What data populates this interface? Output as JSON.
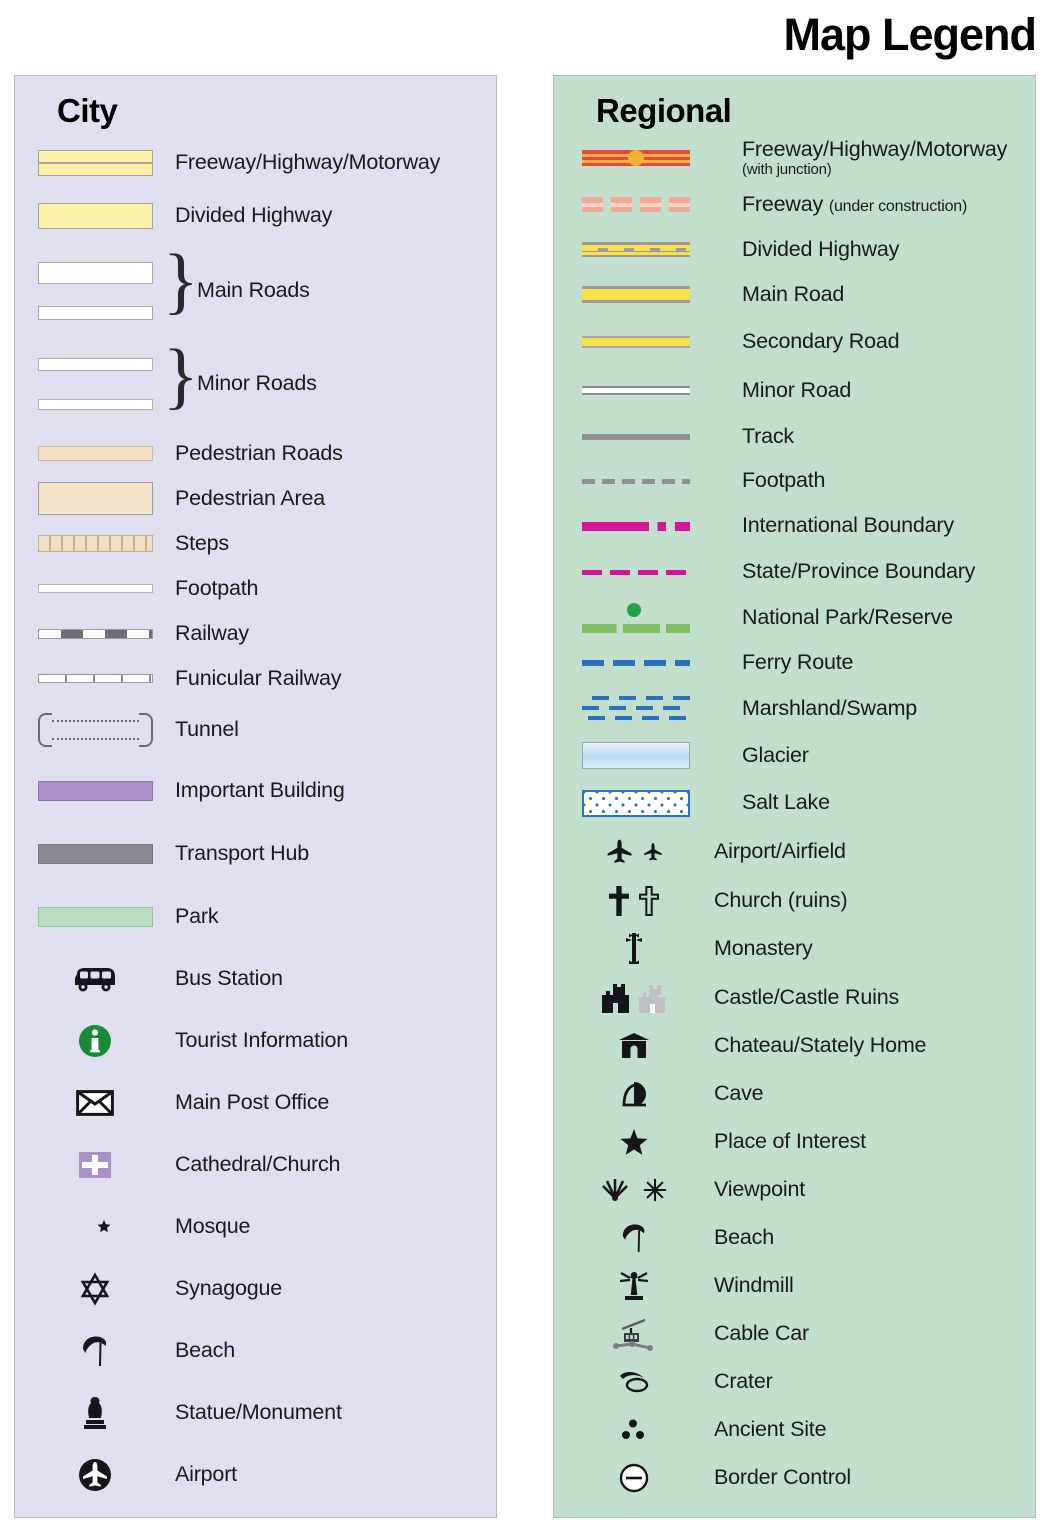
{
  "title": "Map Legend",
  "city": {
    "heading": "City",
    "bg_color": "#e0dff0",
    "items": [
      {
        "label": "Freeway/Highway/Motorway",
        "symbol": "freeway-bar"
      },
      {
        "label": "Divided Highway",
        "symbol": "divided-highway-bar"
      },
      {
        "label": "Main Roads",
        "symbol": "main-roads-pair-braced"
      },
      {
        "label": "Minor Roads",
        "symbol": "minor-roads-pair-braced"
      },
      {
        "label": "Pedestrian Roads",
        "symbol": "pedestrian-road-bar"
      },
      {
        "label": "Pedestrian Area",
        "symbol": "pedestrian-area-bar"
      },
      {
        "label": "Steps",
        "symbol": "steps-bar"
      },
      {
        "label": "Footpath",
        "symbol": "footpath-bar"
      },
      {
        "label": "Railway",
        "symbol": "railway-bar"
      },
      {
        "label": "Funicular Railway",
        "symbol": "funicular-railway-bar"
      },
      {
        "label": "Tunnel",
        "symbol": "tunnel-bracket"
      },
      {
        "label": "Important Building",
        "symbol": "important-building-bar"
      },
      {
        "label": "Transport Hub",
        "symbol": "transport-hub-bar"
      },
      {
        "label": "Park",
        "symbol": "park-bar"
      },
      {
        "label": "Bus Station",
        "symbol": "bus-icon"
      },
      {
        "label": "Tourist Information",
        "symbol": "info-circle-icon"
      },
      {
        "label": "Main Post Office",
        "symbol": "envelope-icon"
      },
      {
        "label": "Cathedral/Church",
        "symbol": "cross-square-icon"
      },
      {
        "label": "Mosque",
        "symbol": "crescent-star-icon"
      },
      {
        "label": "Synagogue",
        "symbol": "star-of-david-icon"
      },
      {
        "label": "Beach",
        "symbol": "beach-umbrella-icon"
      },
      {
        "label": "Statue/Monument",
        "symbol": "statue-icon"
      },
      {
        "label": "Airport",
        "symbol": "airport-circle-icon"
      }
    ]
  },
  "regional": {
    "heading": "Regional",
    "bg_color": "#c2dfcd",
    "items": [
      {
        "label": "Freeway/Highway/Motorway",
        "sub": "(with junction)",
        "symbol": "freeway-junction-line"
      },
      {
        "label": "Freeway ",
        "inline_sub": "(under construction)",
        "symbol": "freeway-under-construction-line"
      },
      {
        "label": "Divided Highway",
        "symbol": "divided-highway-line"
      },
      {
        "label": "Main Road",
        "symbol": "main-road-line"
      },
      {
        "label": "Secondary Road",
        "symbol": "secondary-road-line"
      },
      {
        "label": "Minor Road",
        "symbol": "minor-road-line"
      },
      {
        "label": "Track",
        "symbol": "track-line"
      },
      {
        "label": "Footpath",
        "symbol": "footpath-dashed-line"
      },
      {
        "label": "International Boundary",
        "symbol": "international-boundary-line"
      },
      {
        "label": "State/Province Boundary",
        "symbol": "state-boundary-line"
      },
      {
        "label": "National Park/Reserve",
        "symbol": "national-park-line"
      },
      {
        "label": "Ferry Route",
        "symbol": "ferry-route-line"
      },
      {
        "label": "Marshland/Swamp",
        "symbol": "marshland-pattern"
      },
      {
        "label": "Glacier",
        "symbol": "glacier-swatch"
      },
      {
        "label": "Salt Lake",
        "symbol": "salt-lake-swatch"
      },
      {
        "label": "Airport/Airfield",
        "symbol": "airplane-pair-icon"
      },
      {
        "label": "Church (ruins)",
        "symbol": "cross-pair-icon"
      },
      {
        "label": "Monastery",
        "symbol": "monastery-cross-icon"
      },
      {
        "label": "Castle/Castle Ruins",
        "symbol": "castle-pair-icon"
      },
      {
        "label": "Chateau/Stately Home",
        "symbol": "chateau-icon"
      },
      {
        "label": "Cave",
        "symbol": "cave-icon"
      },
      {
        "label": "Place of Interest",
        "symbol": "star-icon"
      },
      {
        "label": "Viewpoint",
        "symbol": "viewpoint-pair-icon"
      },
      {
        "label": "Beach",
        "symbol": "beach-umbrella-icon"
      },
      {
        "label": "Windmill",
        "symbol": "windmill-icon"
      },
      {
        "label": "Cable Car",
        "symbol": "cable-car-icon"
      },
      {
        "label": "Crater",
        "symbol": "crater-icon"
      },
      {
        "label": "Ancient Site",
        "symbol": "ancient-site-icon"
      },
      {
        "label": "Border Control",
        "symbol": "border-control-icon"
      }
    ]
  },
  "colors": {
    "city_panel": "#e0dff0",
    "regional_panel": "#c2dfcd",
    "highway_yellow": "#fbf0a8",
    "freeway_red": "#e04a43",
    "junction_orange": "#f4b233",
    "main_road_yellow": "#f7e04a",
    "boundary_magenta": "#d4159a",
    "park_green": "#7cc063",
    "ferry_blue": "#2a6fc4",
    "pedestrian_tan": "#f2e2c8",
    "important_building_purple": "#ab8fc8",
    "transport_hub_grey": "#8a8a8f",
    "park_swatch_green": "#b9dfc0",
    "info_green": "#1a8a38"
  }
}
